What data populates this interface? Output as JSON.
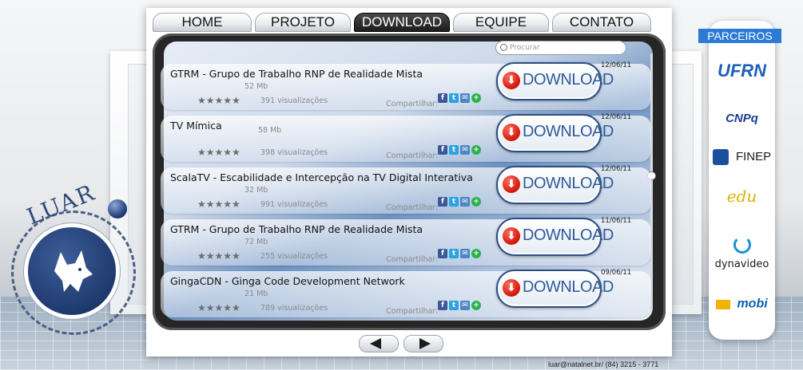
{
  "nav": {
    "tabs": [
      {
        "label": "HOME",
        "active": false
      },
      {
        "label": "PROJETO",
        "active": false
      },
      {
        "label": "DOWNLOAD",
        "active": true
      },
      {
        "label": "EQUIPE",
        "active": false
      },
      {
        "label": "CONTATO",
        "active": false
      }
    ]
  },
  "brand": {
    "logo_text": "LUAR"
  },
  "search": {
    "placeholder": "Procurar"
  },
  "download_label": "DOWNLOAD",
  "share_label": "Compartilhar:",
  "items": [
    {
      "title": "GTRM - Grupo de Trabalho RNP de Realidade Mista",
      "size": "52 Mb",
      "views": "391 visualizações",
      "date": "12/06/11"
    },
    {
      "title": "TV Mímica",
      "size": "58 Mb",
      "views": "398 visualizações",
      "date": "12/06/11"
    },
    {
      "title": "ScalaTV - Escabilidade e Intercepção na TV Digital Interativa",
      "size": "32 Mb",
      "views": "991 visualizações",
      "date": "12/06/11"
    },
    {
      "title": "GTRM - Grupo de Trabalho RNP de Realidade Mista",
      "size": "72 Mb",
      "views": "255 visualizações",
      "date": "11/06/11"
    },
    {
      "title": "GingaCDN - Ginga Code Development Network",
      "size": "21 Mb",
      "views": "789 visualizações",
      "date": "09/06/11"
    }
  ],
  "rating_stars": "★★★★★",
  "partners": {
    "heading": "PARCEIROS",
    "logos": [
      {
        "name": "UFRN",
        "color": "#1d5fb8"
      },
      {
        "name": "CNPq",
        "color": "#1a3f8f"
      },
      {
        "name": "FINEP",
        "color": "#1c4f9c"
      },
      {
        "name": "edu",
        "color": "#d8b400"
      },
      {
        "name": "dynavideo",
        "color": "#1a1a1a"
      },
      {
        "name": "mobi",
        "color": "#0a5fb5"
      }
    ]
  },
  "footer": {
    "contact": "luar@natalnet.br/ (84) 3215 - 3771"
  },
  "colors": {
    "accent": "#2a7ad6",
    "download_text": "#2d5b9a",
    "download_icon": "#d0160a"
  }
}
